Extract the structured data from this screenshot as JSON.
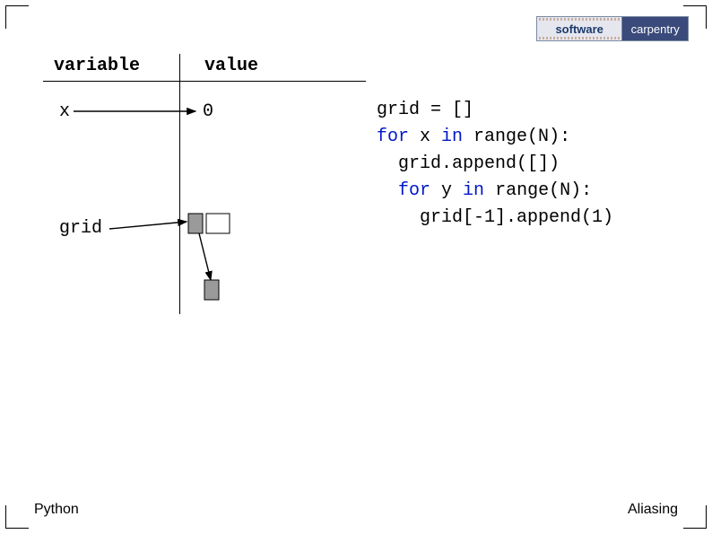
{
  "logo": {
    "left": "software",
    "right": "carpentry"
  },
  "table": {
    "header_col1": "variable",
    "header_col2": "value",
    "rows": {
      "x": {
        "name": "x",
        "value": "0"
      },
      "grid": {
        "name": "grid"
      }
    }
  },
  "code": {
    "l1_a": "grid = []",
    "l2_kw": "for",
    "l2_a": " x ",
    "l2_kw2": "in",
    "l2_b": " range(N):",
    "l3_a": "  grid.append([])",
    "l4_kw": "for",
    "l4_a": " y ",
    "l4_kw2": "in",
    "l4_b": " range(N):",
    "l5_a": "    grid[-1].append(1)"
  },
  "footer": {
    "left": "Python",
    "right": "Aliasing"
  }
}
